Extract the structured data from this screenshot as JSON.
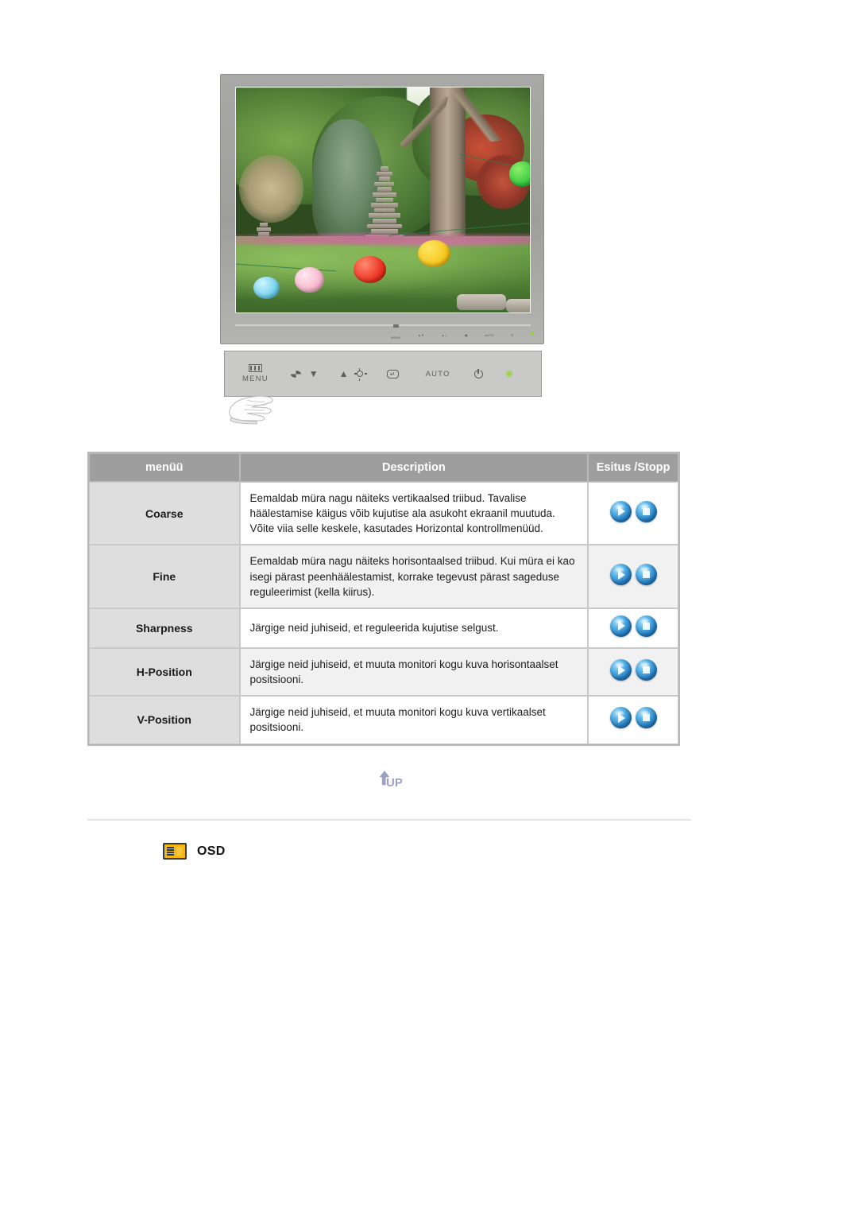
{
  "monitor": {
    "alt_name": "samsung-lcd-monitor-front",
    "control_panel": {
      "menu_label": "MENU",
      "auto_label": "AUTO",
      "icons": [
        "menu-icon",
        "source-icon",
        "down-arrow-icon",
        "up-arrow-icon",
        "brightness-icon",
        "enter-icon",
        "auto-button",
        "power-icon",
        "power-led-indicator"
      ]
    },
    "screen_photo_caption": "korean-garden-with-stone-pagoda-and-paper-lanterns"
  },
  "table": {
    "headers": {
      "menu": "menüü",
      "description": "Description",
      "play": "Esitus /Stopp"
    },
    "rows": [
      {
        "menu": "Coarse",
        "description": "Eemaldab müra nagu näiteks vertikaalsed triibud. Tavalise häälestamise käigus võib kujutise ala asukoht ekraanil muutuda.\nVõite viia selle keskele, kasutades Horizontal kontrollmenüüd.",
        "play_button": "play-button",
        "stop_button": "stop-button"
      },
      {
        "menu": "Fine",
        "description": "Eemaldab müra nagu näiteks horisontaalsed triibud. Kui müra ei kao isegi pärast peenhäälestamist, korrake tegevust pärast sageduse reguleerimist (kella kiirus).",
        "play_button": "play-button",
        "stop_button": "stop-button"
      },
      {
        "menu": "Sharpness",
        "description": "Järgige neid juhiseid, et reguleerida kujutise selgust.",
        "play_button": "play-button",
        "stop_button": "stop-button"
      },
      {
        "menu": "H-Position",
        "description": "Järgige neid juhiseid, et muuta monitori kogu kuva horisontaalset positsiooni.",
        "play_button": "play-button",
        "stop_button": "stop-button"
      },
      {
        "menu": "V-Position",
        "description": "Järgige neid juhiseid, et muuta monitori kogu kuva vertikaalset positsiooni.",
        "play_button": "play-button",
        "stop_button": "stop-button"
      }
    ]
  },
  "up_button": {
    "label": "UP"
  },
  "osd_section": {
    "label": "OSD",
    "icon": "osd-icon"
  },
  "colors": {
    "header_bg": "#9e9e9e",
    "menu_cell_bg": "#dedede",
    "alt_row_bg": "#f1f1f1",
    "orb_blue": "#2b86cc",
    "osd_yellow": "#f5b711",
    "led_green": "#9bd63c"
  }
}
